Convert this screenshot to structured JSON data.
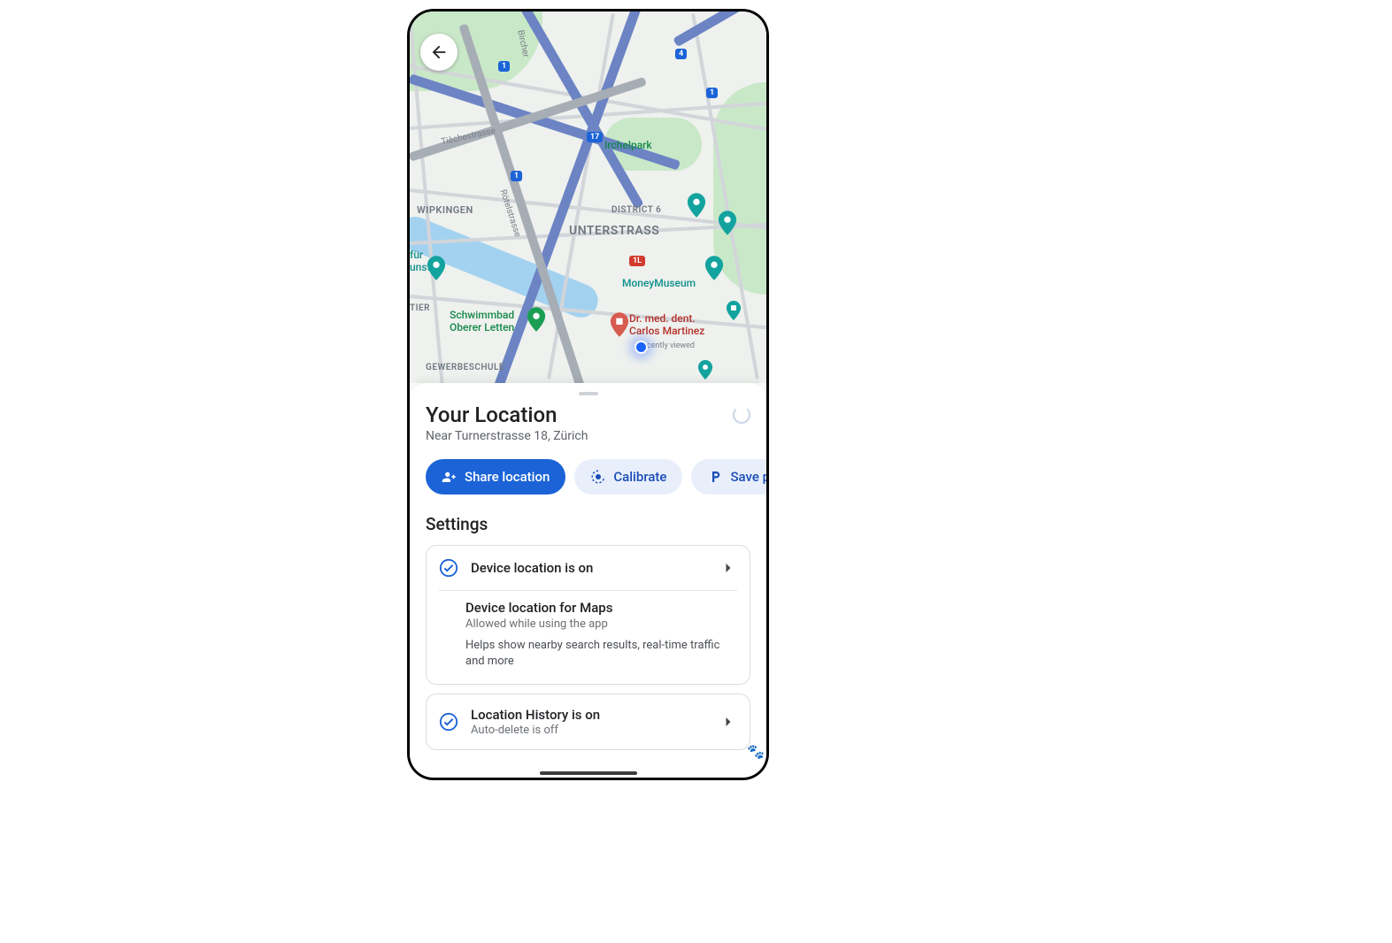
{
  "sheet": {
    "title": "Your Location",
    "subtitle": "Near Turnerstrasse 18, Zürich",
    "settings_heading": "Settings"
  },
  "chips": {
    "share": "Share location",
    "calibrate": "Calibrate",
    "save_parking": "Save parking"
  },
  "cards": {
    "device_location": {
      "title": "Device location is on",
      "body_title": "Device location for Maps",
      "body_sub": "Allowed while using the app",
      "body_desc": "Helps show nearby search results, real-time traffic and more"
    },
    "location_history": {
      "title": "Location History is on",
      "sub": "Auto-delete is off"
    }
  },
  "map": {
    "districts": {
      "unterstrass": "UNTERSTRASS",
      "wipkingen": "WIPKINGEN",
      "district6": "DISTRICT 6",
      "gewerbeschule": "GEWERBESCHULE",
      "tier": "TIER"
    },
    "streets": {
      "tieche": "Tièchestrasse",
      "bircher": "Bircher",
      "rotel": "Rötelstrasse"
    },
    "poi": {
      "irchelpark": "Irchelpark",
      "schwimmbad": "Schwimmbad\nOberer Letten",
      "museum_kunst": "für\nunst",
      "money_museum": "MoneyMuseum",
      "dentist": "Dr. med. dent.\nCarlos Martinez",
      "recently_viewed": "cently viewed"
    },
    "shields": {
      "s1a": "1",
      "s1b": "1",
      "s1c": "1",
      "s4": "4",
      "s17": "17",
      "s1l": "1L"
    }
  }
}
